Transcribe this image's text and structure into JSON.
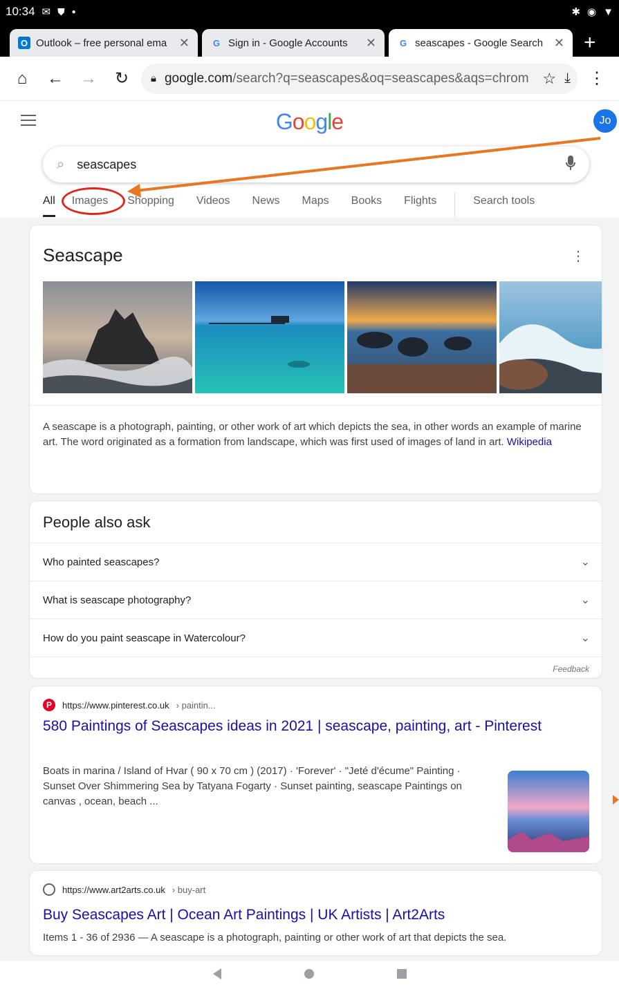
{
  "status_bar": {
    "time": "10:34"
  },
  "tabs": [
    {
      "label": "Outlook – free personal ema",
      "favicon": "O"
    },
    {
      "label": "Sign in - Google Accounts",
      "favicon": "G"
    },
    {
      "label": "seascapes - Google Search",
      "favicon": "G"
    }
  ],
  "address_bar": {
    "domain": "google.com",
    "path": "/search?q=seascapes&oq=seascapes&aqs=chrom"
  },
  "google": {
    "logo": "Google",
    "avatar": "Jo"
  },
  "search": {
    "query": "seascapes"
  },
  "nav_tabs": [
    "All",
    "Images",
    "Shopping",
    "Videos",
    "News",
    "Maps",
    "Books",
    "Flights"
  ],
  "search_tools": "Search tools",
  "knowledge_panel": {
    "title": "Seascape",
    "description": "A seascape is a photograph, painting, or other work of art which depicts the sea, in other words an example of marine art. The word originated as a formation from landscape, which was first used of images of land in art.",
    "source": "Wikipedia"
  },
  "people_also_ask": {
    "title": "People also ask",
    "questions": [
      "Who painted seascapes?",
      "What is seascape photography?",
      "How do you paint seascape in Watercolour?"
    ],
    "feedback": "Feedback"
  },
  "results": [
    {
      "url": "https://www.pinterest.co.uk",
      "crumb": "› paintin...",
      "title": "580 Paintings of Seascapes ideas in 2021 | seascape, painting, art - Pinterest",
      "snippet": "Boats in marina / Island of Hvar ( 90 x 70 cm ) (2017) · 'Forever' · \"Jeté d'écume\" Painting · Sunset Over Shimmering Sea by Tatyana Fogarty · Sunset painting, seascape Paintings on canvas , ocean, beach ..."
    },
    {
      "url": "https://www.art2arts.co.uk",
      "crumb": "› buy-art",
      "title": "Buy Seascapes Art | Ocean Art Paintings | UK Artists | Art2Arts",
      "snippet": "Items 1 - 36 of 2936 — A seascape is a photograph, painting or other work of art that depicts the sea."
    }
  ],
  "colors": {
    "link": "#1a0dab",
    "annotation_oval": "#e0261c",
    "annotation_arrow": "#e87722"
  }
}
